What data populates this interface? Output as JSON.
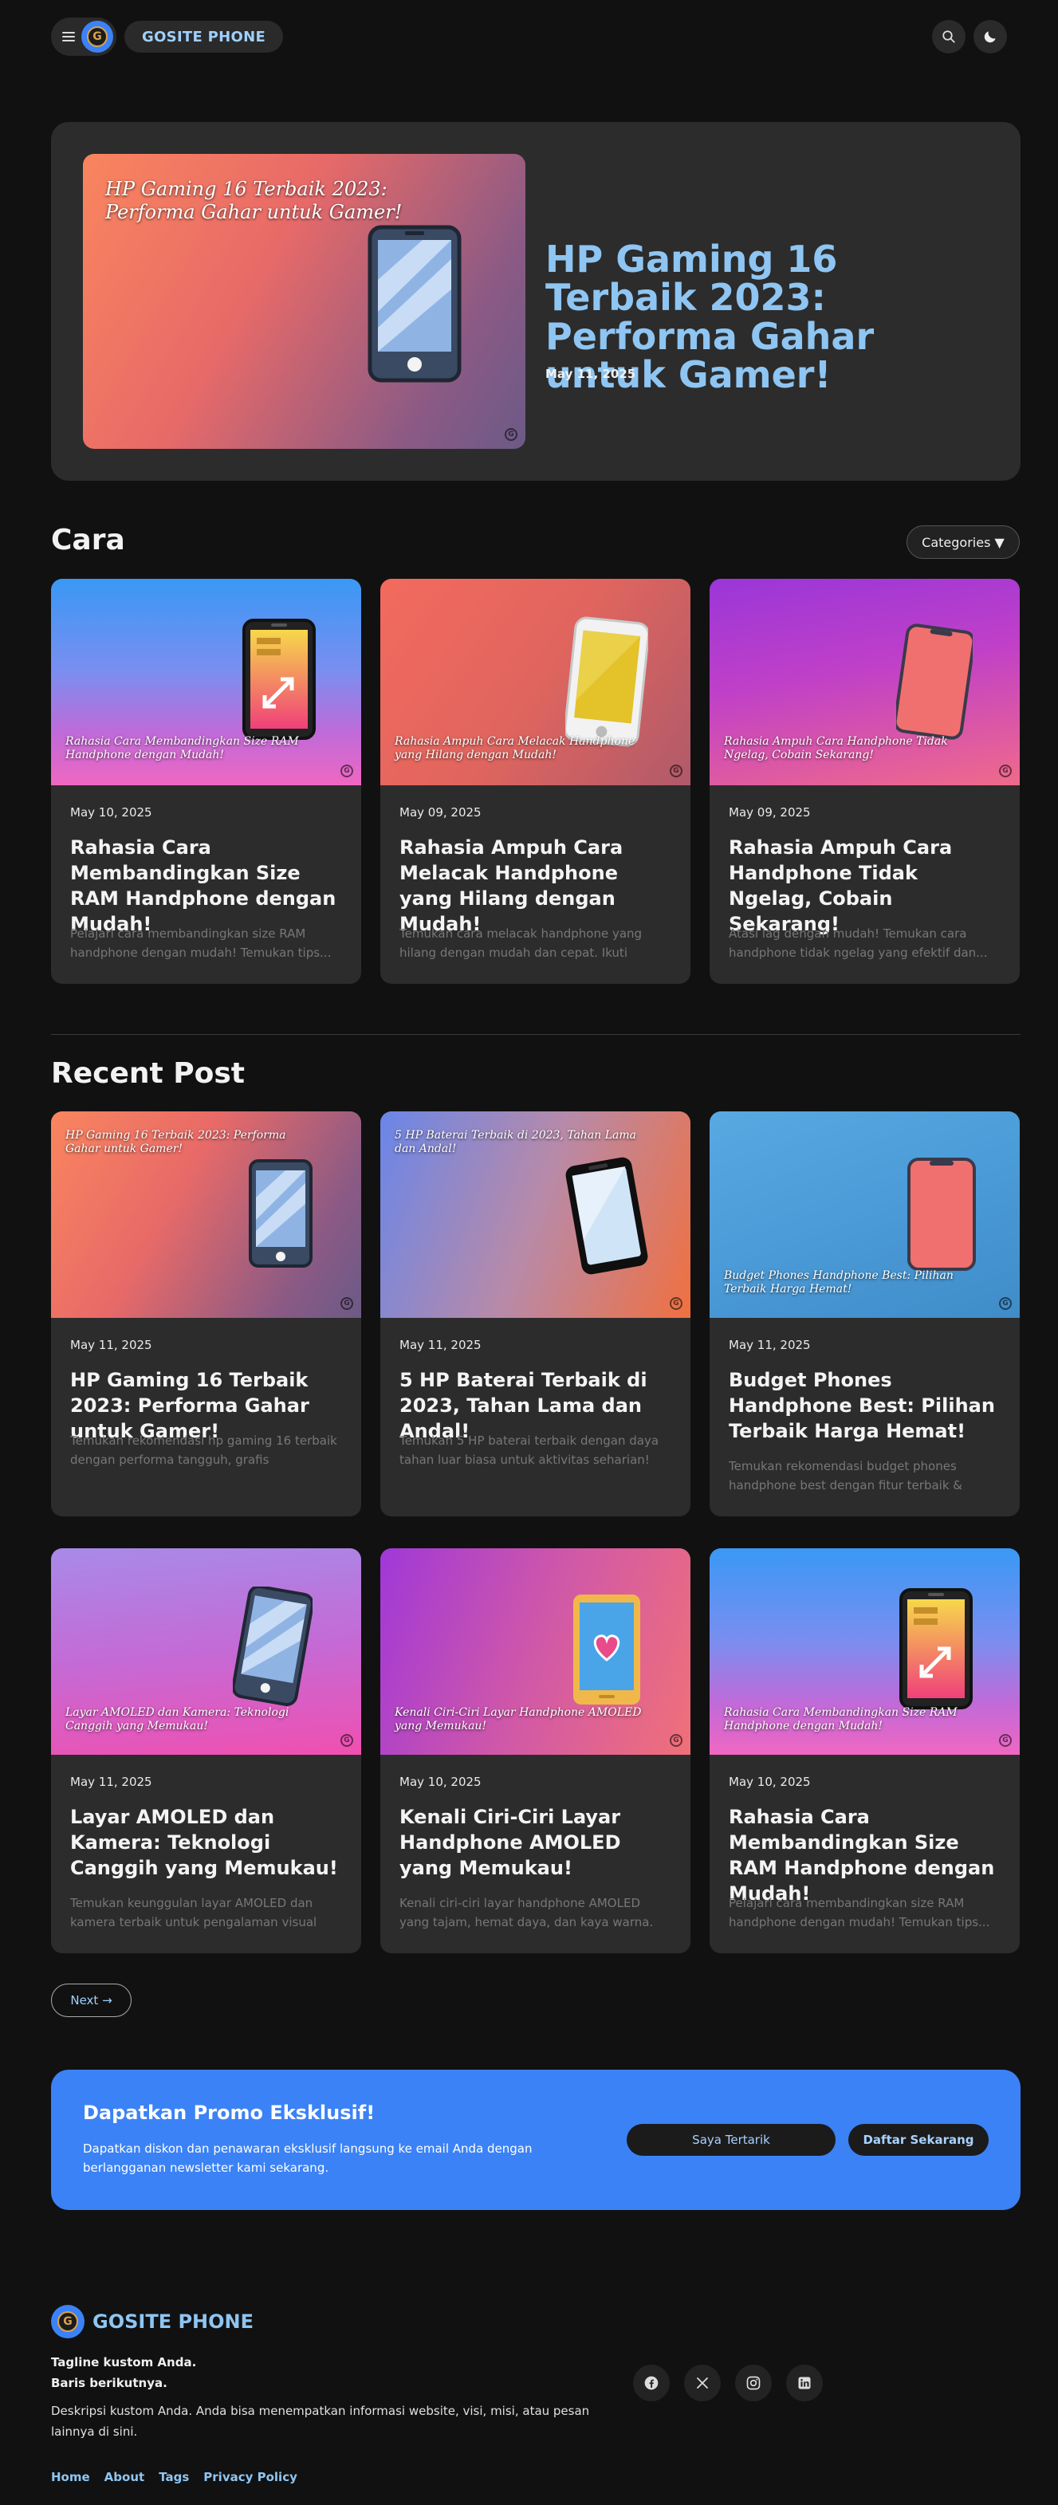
{
  "header": {
    "site_name": "GOSITE PHONE",
    "logo_letter": "G",
    "icons": [
      "menu-icon",
      "search-icon",
      "moon-icon"
    ]
  },
  "hero": {
    "image_caption": "HP Gaming 16 Terbaik 2023: Performa Gahar untuk Gamer!",
    "title": "HP Gaming 16 Terbaik 2023: Performa Gahar untuk Gamer!",
    "date": "May 11, 2025"
  },
  "cara": {
    "title": "Cara",
    "categories_label": "Categories ▼",
    "cards": [
      {
        "caption": "Rahasia Cara Membandingkan Size RAM Handphone dengan Mudah!",
        "date": "May 10, 2025",
        "title": "Rahasia Cara Membandingkan Size RAM Handphone dengan Mudah!",
        "excerpt": "Pelajari cara membandingkan size RAM handphone dengan mudah! Temukan tips..."
      },
      {
        "caption": "Rahasia Ampuh Cara Melacak Handphone yang Hilang dengan Mudah!",
        "date": "May 09, 2025",
        "title": "Rahasia Ampuh Cara Melacak Handphone yang Hilang dengan Mudah!",
        "excerpt": "Temukan cara melacak handphone yang hilang dengan mudah dan cepat. Ikuti langkah prakti..."
      },
      {
        "caption": "Rahasia Ampuh Cara Handphone Tidak Ngelag, Cobain Sekarang!",
        "date": "May 09, 2025",
        "title": "Rahasia Ampuh Cara Handphone Tidak Ngelag, Cobain Sekarang!",
        "excerpt": "Atasi lag dengan mudah! Temukan cara handphone tidak ngelag yang efektif dan..."
      }
    ]
  },
  "recent": {
    "title": "Recent Post",
    "cards": [
      {
        "caption": "HP Gaming 16 Terbaik 2023: Performa Gahar untuk Gamer!",
        "date": "May 11, 2025",
        "title": "HP Gaming 16 Terbaik 2023: Performa Gahar untuk Gamer!",
        "excerpt": "Temukan rekomendasi hp gaming 16 terbaik dengan performa tangguh, grafis memukau,..."
      },
      {
        "caption": "5 HP Baterai Terbaik di 2023, Tahan Lama dan Andal!",
        "date": "May 11, 2025",
        "title": "5 HP Baterai Terbaik di 2023, Tahan Lama dan Andal!",
        "excerpt": "Temukan 5 HP baterai terbaik dengan daya tahan luar biasa untuk aktivitas seharian! Pilih..."
      },
      {
        "caption": "Budget Phones Handphone Best: Pilihan Terbaik Harga Hemat!",
        "date": "May 11, 2025",
        "title": "Budget Phones Handphone Best: Pilihan Terbaik Harga Hemat!",
        "excerpt": "Temukan rekomendasi budget phones handphone best dengan fitur terbaik & harga..."
      },
      {
        "caption": "Layar AMOLED dan Kamera: Teknologi Canggih yang Memukau!",
        "date": "May 11, 2025",
        "title": "Layar AMOLED dan Kamera: Teknologi Canggih yang Memukau!",
        "excerpt": "Temukan keunggulan layar AMOLED dan kamera terbaik untuk pengalaman visual dan..."
      },
      {
        "caption": "Kenali Ciri-Ciri Layar Handphone AMOLED yang Memukau!",
        "date": "May 10, 2025",
        "title": "Kenali Ciri-Ciri Layar Handphone AMOLED yang Memukau!",
        "excerpt": "Kenali ciri-ciri layar handphone AMOLED yang tajam, hemat daya, dan kaya warna. Temukan..."
      },
      {
        "caption": "Rahasia Cara Membandingkan Size RAM Handphone dengan Mudah!",
        "date": "May 10, 2025",
        "title": "Rahasia Cara Membandingkan Size RAM Handphone dengan Mudah!",
        "excerpt": "Pelajari cara membandingkan size RAM handphone dengan mudah! Temukan tips..."
      }
    ],
    "next_label": "Next →"
  },
  "promo": {
    "title": "Dapatkan Promo Eksklusif!",
    "description": "Dapatkan diskon dan penawaran eksklusif langsung ke email Anda dengan berlangganan newsletter kami sekarang.",
    "interest_button": "Saya Tertarik",
    "signup_button": "Daftar Sekarang"
  },
  "footer": {
    "site_name": "GOSITE PHONE",
    "tagline_line1": "Tagline kustom Anda.",
    "tagline_line2": "Baris berikutnya.",
    "description": "Deskripsi kustom Anda. Anda bisa menempatkan informasi website, visi, misi, atau pesan lainnya di sini.",
    "links": [
      "Home",
      "About",
      "Tags",
      "Privacy Policy"
    ],
    "social_icons": [
      "facebook-icon",
      "x-icon",
      "instagram-icon",
      "linkedin-icon"
    ]
  },
  "colors": {
    "accent": "#3b82f6",
    "title_blue": "#8ec5f2",
    "background": "#111111",
    "card": "#2c2c2c"
  }
}
